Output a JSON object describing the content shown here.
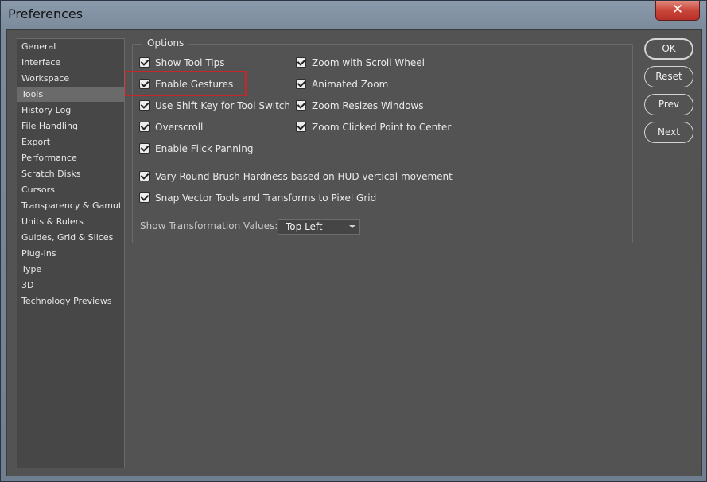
{
  "window": {
    "title": "Preferences",
    "close_glyph": "✕"
  },
  "sidebar": {
    "items": [
      {
        "label": "General"
      },
      {
        "label": "Interface"
      },
      {
        "label": "Workspace"
      },
      {
        "label": "Tools",
        "selected": true
      },
      {
        "label": "History Log"
      },
      {
        "label": "File Handling"
      },
      {
        "label": "Export"
      },
      {
        "label": "Performance"
      },
      {
        "label": "Scratch Disks"
      },
      {
        "label": "Cursors"
      },
      {
        "label": "Transparency & Gamut"
      },
      {
        "label": "Units & Rulers"
      },
      {
        "label": "Guides, Grid & Slices"
      },
      {
        "label": "Plug-Ins"
      },
      {
        "label": "Type"
      },
      {
        "label": "3D"
      },
      {
        "label": "Technology Previews"
      }
    ]
  },
  "options": {
    "legend": "Options",
    "left_column": [
      {
        "label": "Show Tool Tips",
        "checked": true
      },
      {
        "label": "Enable Gestures",
        "checked": true
      },
      {
        "label": "Use Shift Key for Tool Switch",
        "checked": true
      },
      {
        "label": "Overscroll",
        "checked": true
      },
      {
        "label": "Enable Flick Panning",
        "checked": true
      }
    ],
    "right_column": [
      {
        "label": "Zoom with Scroll Wheel",
        "checked": true
      },
      {
        "label": "Animated Zoom",
        "checked": true
      },
      {
        "label": "Zoom Resizes Windows",
        "checked": true
      },
      {
        "label": "Zoom Clicked Point to Center",
        "checked": true
      }
    ],
    "wide": [
      {
        "label": "Vary Round Brush Hardness based on HUD vertical movement",
        "checked": true
      },
      {
        "label": "Snap Vector Tools and Transforms to Pixel Grid",
        "checked": true
      }
    ],
    "transformation_values": {
      "label": "Show Transformation Values:",
      "selected": "Top Left"
    }
  },
  "buttons": {
    "ok": "OK",
    "reset": "Reset",
    "prev": "Prev",
    "next": "Next"
  },
  "colors": {
    "highlight": "#c62828",
    "selected_item": "#6a6a6a",
    "panel": "#535353"
  }
}
